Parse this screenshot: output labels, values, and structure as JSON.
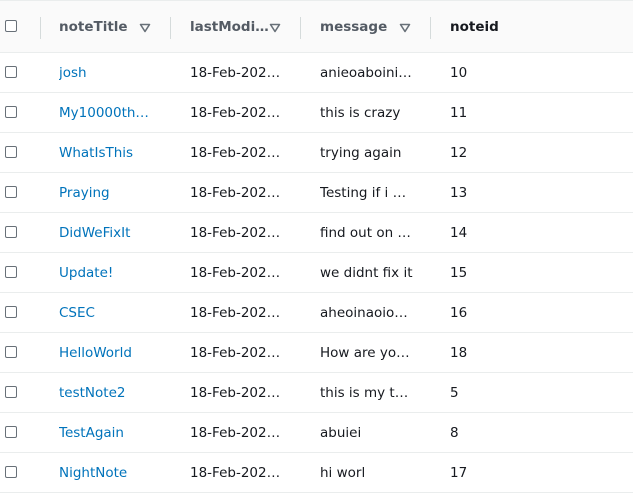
{
  "columns": {
    "noteTitle": "noteTitle",
    "lastModified": "lastModi…",
    "message": "message",
    "noteid": "noteid"
  },
  "rows": [
    {
      "title": "josh",
      "modified": "18-Feb-202…",
      "message": "anieoaboini…",
      "id": "10"
    },
    {
      "title": "My10000th…",
      "modified": "18-Feb-202…",
      "message": "this is crazy",
      "id": "11"
    },
    {
      "title": "WhatIsThis",
      "modified": "18-Feb-202…",
      "message": "trying again",
      "id": "12"
    },
    {
      "title": "Praying",
      "modified": "18-Feb-202…",
      "message": "Testing if i …",
      "id": "13"
    },
    {
      "title": "DidWeFixIt",
      "modified": "18-Feb-202…",
      "message": "find out on …",
      "id": "14"
    },
    {
      "title": "Update!",
      "modified": "18-Feb-202…",
      "message": "we didnt fix it",
      "id": "15"
    },
    {
      "title": "CSEC",
      "modified": "18-Feb-202…",
      "message": "aheoinaoio…",
      "id": "16"
    },
    {
      "title": "HelloWorld",
      "modified": "18-Feb-202…",
      "message": "How are yo…",
      "id": "18"
    },
    {
      "title": "testNote2",
      "modified": "18-Feb-202…",
      "message": "this is my t…",
      "id": "5"
    },
    {
      "title": "TestAgain",
      "modified": "18-Feb-202…",
      "message": "abuiei",
      "id": "8"
    },
    {
      "title": "NightNote",
      "modified": "18-Feb-202…",
      "message": "hi worl",
      "id": "17"
    }
  ],
  "colors": {
    "link": "#0073bb",
    "header_bg": "#fafafa",
    "border": "#eaeded"
  },
  "icons": {
    "select_all": "checkbox-icon",
    "sort": "sort-down-triangle-icon"
  }
}
